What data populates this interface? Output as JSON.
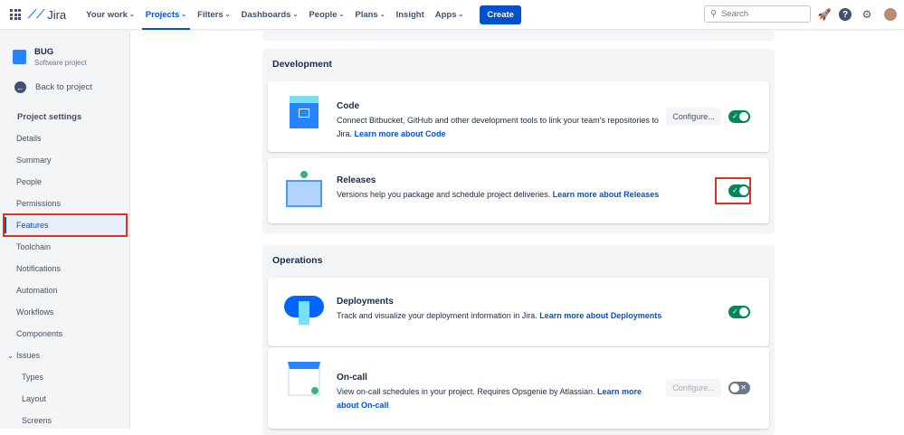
{
  "topnav": {
    "product": "Jira",
    "items": [
      {
        "label": "Your work",
        "chev": true
      },
      {
        "label": "Projects",
        "chev": true,
        "active": true
      },
      {
        "label": "Filters",
        "chev": true
      },
      {
        "label": "Dashboards",
        "chev": true
      },
      {
        "label": "People",
        "chev": true
      },
      {
        "label": "Plans",
        "chev": true
      },
      {
        "label": "Insight",
        "chev": false
      },
      {
        "label": "Apps",
        "chev": true
      }
    ],
    "create": "Create",
    "search_placeholder": "Search"
  },
  "sidebar": {
    "project_name": "BUG",
    "project_type": "Software project",
    "back": "Back to project",
    "section_title": "Project settings",
    "items": [
      {
        "label": "Details"
      },
      {
        "label": "Summary"
      },
      {
        "label": "People"
      },
      {
        "label": "Permissions"
      },
      {
        "label": "Features",
        "active": true
      },
      {
        "label": "Toolchain"
      },
      {
        "label": "Notifications"
      },
      {
        "label": "Automation"
      },
      {
        "label": "Workflows"
      },
      {
        "label": "Components"
      },
      {
        "label": "Issues",
        "expand": true
      },
      {
        "label": "Types",
        "sub": true
      },
      {
        "label": "Layout",
        "sub": true
      },
      {
        "label": "Screens",
        "sub": true
      }
    ]
  },
  "sections": [
    {
      "title": "Development",
      "features": [
        {
          "title": "Code",
          "desc": "Connect Bitbucket, GitHub and other development tools to link your team's repositories to Jira.",
          "link": "Learn more about Code",
          "configure": "Configure...",
          "enabled": true
        },
        {
          "title": "Releases",
          "desc": "Versions help you package and schedule project deliveries.",
          "link": "Learn more about Releases",
          "enabled": true
        }
      ]
    },
    {
      "title": "Operations",
      "features": [
        {
          "title": "Deployments",
          "desc": "Track and visualize your deployment information in Jira.",
          "link": "Learn more about Deployments",
          "enabled": true
        },
        {
          "title": "On-call",
          "desc": "View on-call schedules in your project. Requires Opsgenie by Atlassian.",
          "link": "Learn more about On-call",
          "configure": "Configure...",
          "enabled": false
        }
      ]
    }
  ]
}
